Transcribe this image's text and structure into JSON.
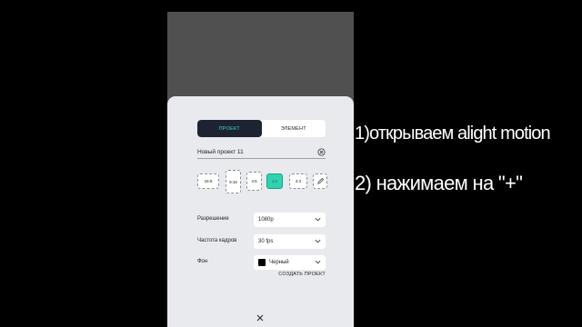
{
  "tabs": [
    "ПРОЕКТ",
    "ЭЛЕМЕНТ"
  ],
  "project_name": "Новый проект 11",
  "aspect_ratios": [
    "16:9",
    "9:16",
    "4:5",
    "1:1",
    "4:3",
    ""
  ],
  "selected_ratio": "1:1",
  "settings": {
    "resolution_label": "Разрешение",
    "resolution_value": "1080p",
    "framerate_label": "Частота кадров",
    "framerate_value": "30 fps",
    "background_label": "Фон",
    "background_value": "Черный"
  },
  "create_label": "СОЗДАТЬ ПРОЕКТ",
  "captions": {
    "line1": "1)открываем alight motion",
    "line2": "2) нажимаем на \"+\""
  },
  "colors": {
    "accent": "#2ed3b0",
    "active_tab_bg": "#1d2331",
    "sheet_bg": "#e9eaee"
  }
}
